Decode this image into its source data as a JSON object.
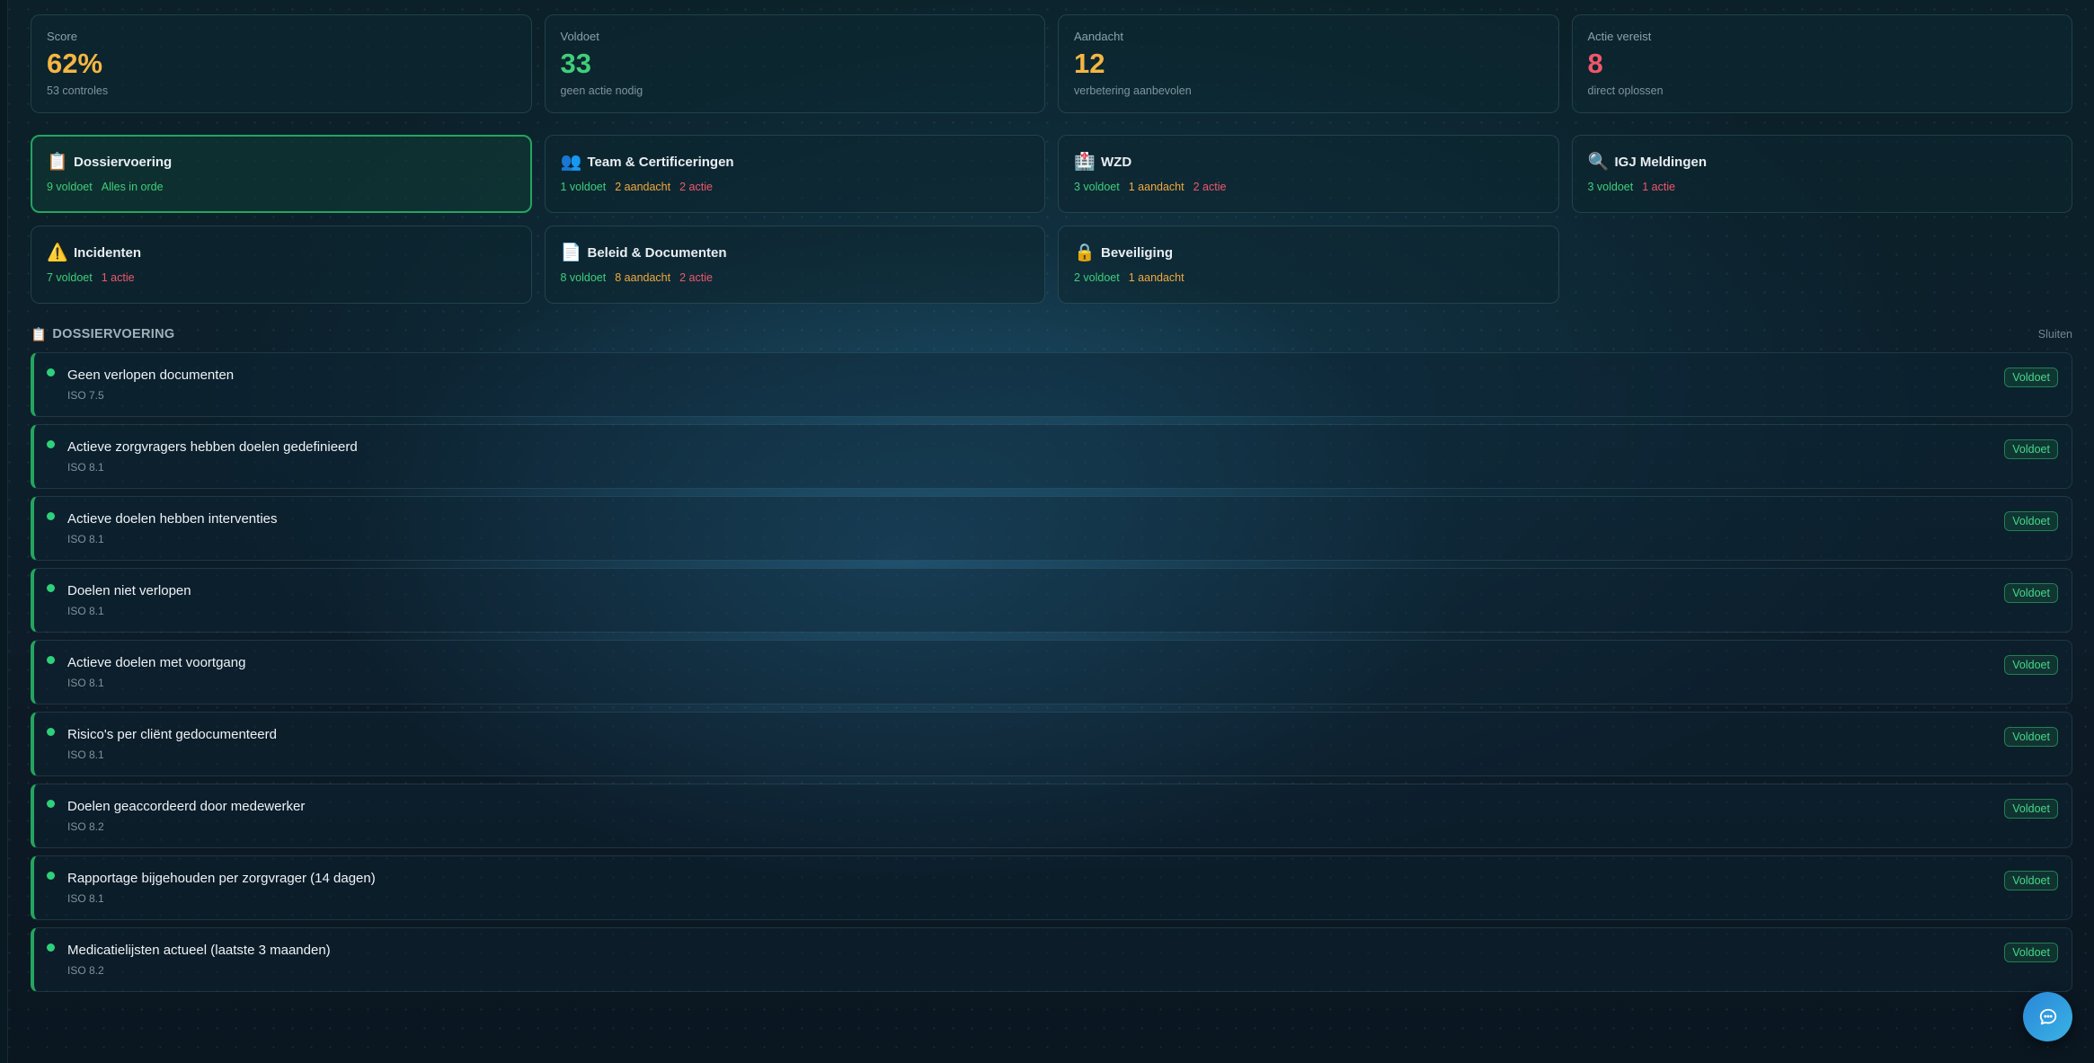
{
  "stats": [
    {
      "label": "Score",
      "value": "62%",
      "sub": "53 controles",
      "color": "#f5b642"
    },
    {
      "label": "Voldoet",
      "value": "33",
      "sub": "geen actie nodig",
      "color": "#3ecf7a"
    },
    {
      "label": "Aandacht",
      "value": "12",
      "sub": "verbetering aanbevolen",
      "color": "#f5b642"
    },
    {
      "label": "Actie vereist",
      "value": "8",
      "sub": "direct oplossen",
      "color": "#f0576a"
    }
  ],
  "categories": [
    {
      "icon": "clipboard-icon",
      "glyph": "📋",
      "title": "Dossiervoering",
      "voldoet": "9 voldoet",
      "aandacht": "",
      "actie": "",
      "ok": "Alles in orde"
    },
    {
      "icon": "people-icon",
      "glyph": "👥",
      "title": "Team & Certificeringen",
      "voldoet": "1 voldoet",
      "aandacht": "2 aandacht",
      "actie": "2 actie",
      "ok": ""
    },
    {
      "icon": "hospital-icon",
      "glyph": "🏥",
      "title": "WZD",
      "voldoet": "3 voldoet",
      "aandacht": "1 aandacht",
      "actie": "2 actie",
      "ok": ""
    },
    {
      "icon": "magnifier-icon",
      "glyph": "🔍",
      "title": "IGJ Meldingen",
      "voldoet": "3 voldoet",
      "aandacht": "",
      "actie": "1 actie",
      "ok": ""
    },
    {
      "icon": "warning-icon",
      "glyph": "⚠️",
      "title": "Incidenten",
      "voldoet": "7 voldoet",
      "aandacht": "",
      "actie": "1 actie",
      "ok": ""
    },
    {
      "icon": "document-icon",
      "glyph": "📄",
      "title": "Beleid & Documenten",
      "voldoet": "8 voldoet",
      "aandacht": "8 aandacht",
      "actie": "2 actie",
      "ok": ""
    },
    {
      "icon": "lock-icon",
      "glyph": "🔒",
      "title": "Beveiliging",
      "voldoet": "2 voldoet",
      "aandacht": "1 aandacht",
      "actie": "",
      "ok": ""
    }
  ],
  "section": {
    "icon": "clipboard-icon",
    "glyph": "📋",
    "title": "DOSSIERVOERING",
    "close_label": "Sluiten"
  },
  "items": [
    {
      "title": "Geen verlopen documenten",
      "code": "ISO 7.5",
      "status": "Voldoet"
    },
    {
      "title": "Actieve zorgvragers hebben doelen gedefinieerd",
      "code": "ISO 8.1",
      "status": "Voldoet"
    },
    {
      "title": "Actieve doelen hebben interventies",
      "code": "ISO 8.1",
      "status": "Voldoet"
    },
    {
      "title": "Doelen niet verlopen",
      "code": "ISO 8.1",
      "status": "Voldoet"
    },
    {
      "title": "Actieve doelen met voortgang",
      "code": "ISO 8.1",
      "status": "Voldoet"
    },
    {
      "title": "Risico's per cliënt gedocumenteerd",
      "code": "ISO 8.1",
      "status": "Voldoet"
    },
    {
      "title": "Doelen geaccordeerd door medewerker",
      "code": "ISO 8.2",
      "status": "Voldoet"
    },
    {
      "title": "Rapportage bijgehouden per zorgvrager (14 dagen)",
      "code": "ISO 8.1",
      "status": "Voldoet"
    },
    {
      "title": "Medicatielijsten actueel (laatste 3 maanden)",
      "code": "ISO 8.2",
      "status": "Voldoet"
    }
  ],
  "chat": {
    "icon": "chat-bubble-icon"
  }
}
